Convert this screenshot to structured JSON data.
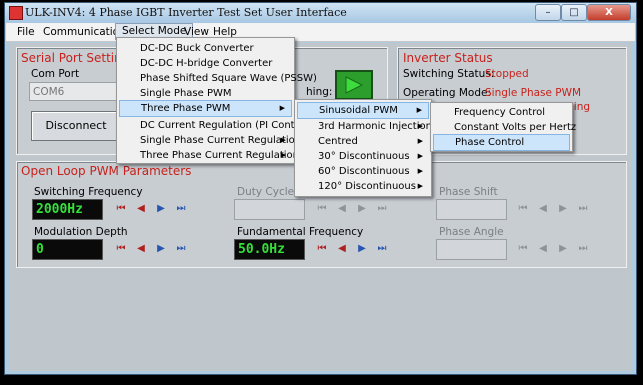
{
  "window": {
    "title": "ULK-INV4: 4 Phase IGBT Inverter Test Set User Interface",
    "controls": {
      "minimize": "–",
      "maximize": "□",
      "close": "X"
    }
  },
  "menubar": [
    "File",
    "Communications",
    "Select Mode",
    "View",
    "Help"
  ],
  "serial": {
    "title": "Serial Port Setting",
    "com_label": "Com Port",
    "com_value": "COM6",
    "disconnect": "Disconnect",
    "switching_label": "hing:"
  },
  "status": {
    "title": "Inverter Status",
    "switching_label": "Switching Status:",
    "switching_value": "Stopped",
    "mode_label": "Operating Mode:",
    "mode_value": "Single Phase PWM",
    "mode_value2": "Two Level Switching"
  },
  "pwm": {
    "title": "Open Loop PWM Parameters",
    "switching_frequency": {
      "label": "Switching Frequency",
      "value": "2000Hz"
    },
    "modulation_depth": {
      "label": "Modulation Depth",
      "value": "0"
    },
    "duty_cycle": {
      "label": "Duty Cycle",
      "value": ""
    },
    "fundamental_frequency": {
      "label": "Fundamental Frequency",
      "value": "50.0Hz"
    },
    "phase_shift": {
      "label": "Phase Shift",
      "value": ""
    },
    "phase_angle": {
      "label": "Phase Angle",
      "value": ""
    }
  },
  "nav_icons": [
    "skip-first-icon",
    "step-back-icon",
    "step-forward-icon",
    "skip-last-icon"
  ],
  "select_mode_menu": [
    "DC-DC Buck Converter",
    "DC-DC H-bridge Converter",
    "Phase Shifted Square Wave (PSSW)",
    "Single Phase PWM",
    "Three Phase PWM",
    "DC Current Regulation (PI Control)",
    "Single Phase Current Regulation",
    "Three Phase Current Regulation"
  ],
  "three_phase_menu": [
    "Sinusoidal PWM",
    "3rd Harmonic Injection",
    "Centred",
    "30° Discontinuous",
    "60° Discontinuous",
    "120° Discontinuous"
  ],
  "sinusoidal_menu": [
    "Frequency Control",
    "Constant Volts per Hertz",
    "Phase Control"
  ]
}
